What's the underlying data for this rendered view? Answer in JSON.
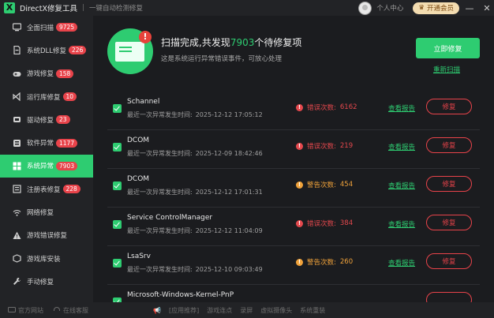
{
  "titlebar": {
    "logo": "X",
    "title": "DirectX修复工具",
    "separator": "|",
    "subtitle": "一键自动检测修复",
    "user_center": "个人中心",
    "vip_label": "开通会员",
    "minimize_glyph": "—",
    "close_glyph": "✕"
  },
  "sidebar": {
    "items": [
      {
        "label": "全面扫描",
        "badge": "9725",
        "icon": "monitor-icon"
      },
      {
        "label": "系统DLL修复",
        "badge": "226",
        "icon": "dll-file-icon"
      },
      {
        "label": "游戏修复",
        "badge": "158",
        "icon": "gamepad-icon"
      },
      {
        "label": "运行库修复",
        "badge": "10",
        "icon": "visual-studio-icon"
      },
      {
        "label": "驱动修复",
        "badge": "23",
        "icon": "driver-icon"
      },
      {
        "label": "软件异常",
        "badge": "1177",
        "icon": "software-icon"
      },
      {
        "label": "系统异常",
        "badge": "7903",
        "icon": "windows-icon"
      },
      {
        "label": "注册表修复",
        "badge": "228",
        "icon": "registry-icon"
      },
      {
        "label": "网络修复",
        "badge": "",
        "icon": "wifi-icon"
      },
      {
        "label": "游戏错误修复",
        "badge": "",
        "icon": "warning-icon"
      },
      {
        "label": "游戏库安装",
        "badge": "",
        "icon": "game-library-icon"
      },
      {
        "label": "手动修复",
        "badge": "",
        "icon": "wrench-icon"
      }
    ]
  },
  "header": {
    "title_prefix": "扫描完成,共发现",
    "count": "7903",
    "title_suffix": "个待修复项",
    "subtitle": "这是系统运行异常错误事件，可放心处理",
    "fix_all": "立即修复",
    "rescan": "重新扫描"
  },
  "rows": [
    {
      "name": "Schannel",
      "time_label": "最近一次异常发生时间:",
      "time": "2025-12-12 17:05:12",
      "severity": "error",
      "stat_label": "错误次数:",
      "stat_value": "6162",
      "report": "查看报告",
      "fix": "修复"
    },
    {
      "name": "DCOM",
      "time_label": "最近一次异常发生时间:",
      "time": "2025-12-09 18:42:46",
      "severity": "error",
      "stat_label": "错误次数:",
      "stat_value": "219",
      "report": "查看报告",
      "fix": "修复"
    },
    {
      "name": "DCOM",
      "time_label": "最近一次异常发生时间:",
      "time": "2025-12-12 17:01:31",
      "severity": "warn",
      "stat_label": "警告次数:",
      "stat_value": "454",
      "report": "查看报告",
      "fix": "修复"
    },
    {
      "name": "Service ControlManager",
      "time_label": "最近一次异常发生时间:",
      "time": "2025-12-12 11:04:09",
      "severity": "error",
      "stat_label": "错误次数:",
      "stat_value": "384",
      "report": "查看报告",
      "fix": "修复"
    },
    {
      "name": "LsaSrv",
      "time_label": "最近一次异常发生时间:",
      "time": "2025-12-10 09:03:49",
      "severity": "warn",
      "stat_label": "警告次数:",
      "stat_value": "260",
      "report": "查看报告",
      "fix": "修复"
    },
    {
      "name": "Microsoft-Windows-Kernel-PnP",
      "time_label": "",
      "time": "",
      "severity": "error",
      "stat_label": "",
      "stat_value": "",
      "report": "",
      "fix": ""
    }
  ],
  "bottombar": {
    "website": "官方网站",
    "support": "在线客服",
    "tools_label": "[应用推荐]",
    "tools": [
      "游戏连点",
      "录屏",
      "虚拟摄像头",
      "系统重装"
    ]
  },
  "colors": {
    "accent": "#2ecc71",
    "error": "#e5484d",
    "warning": "#f0a23a",
    "badge": "#e8434a"
  }
}
